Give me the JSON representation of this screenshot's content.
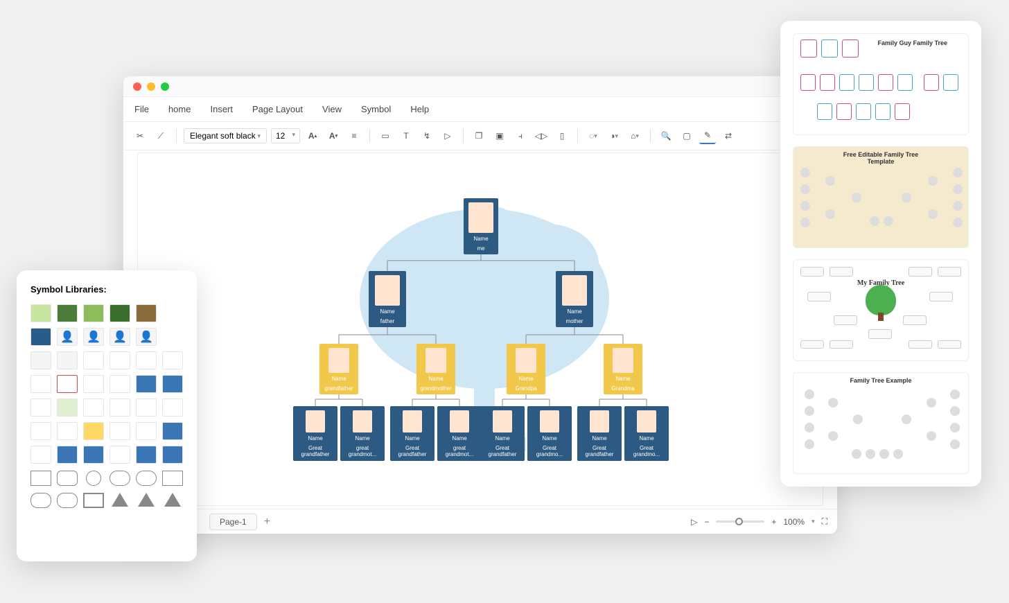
{
  "menubar": [
    "File",
    "home",
    "Insert",
    "Page Layout",
    "View",
    "Symbol",
    "Help"
  ],
  "toolbar": {
    "font_name": "Elegant soft black",
    "font_size": "12"
  },
  "page_tab": "Page-1",
  "zoom": "100%",
  "symbol_panel_title": "Symbol Libraries:",
  "tree": {
    "level1": [
      {
        "name_label": "Name",
        "rel": "me"
      }
    ],
    "level2": [
      {
        "name_label": "Name",
        "rel": "father"
      },
      {
        "name_label": "Name",
        "rel": "mother"
      }
    ],
    "level3": [
      {
        "name_label": "Name",
        "rel": "grandfather"
      },
      {
        "name_label": "Name",
        "rel": "grandmother"
      },
      {
        "name_label": "Name",
        "rel": "Grandpa"
      },
      {
        "name_label": "Name",
        "rel": "Grandma"
      }
    ],
    "level4": [
      {
        "name_label": "Name",
        "rel": "Great grandfather"
      },
      {
        "name_label": "Name",
        "rel": "great grandmot..."
      },
      {
        "name_label": "Name",
        "rel": "Great grandfather"
      },
      {
        "name_label": "Name",
        "rel": "great grandmot..."
      },
      {
        "name_label": "Name",
        "rel": "Great grandfather"
      },
      {
        "name_label": "Name",
        "rel": "Great grandmo..."
      },
      {
        "name_label": "Name",
        "rel": "Great grandfather"
      },
      {
        "name_label": "Name",
        "rel": "Great grandmo..."
      }
    ]
  },
  "templates": {
    "t1": "Family Guy Family Tree",
    "t2": "Free Editable Family Tree Template",
    "t3": "My Family Tree",
    "t4": "Family Tree Example"
  }
}
